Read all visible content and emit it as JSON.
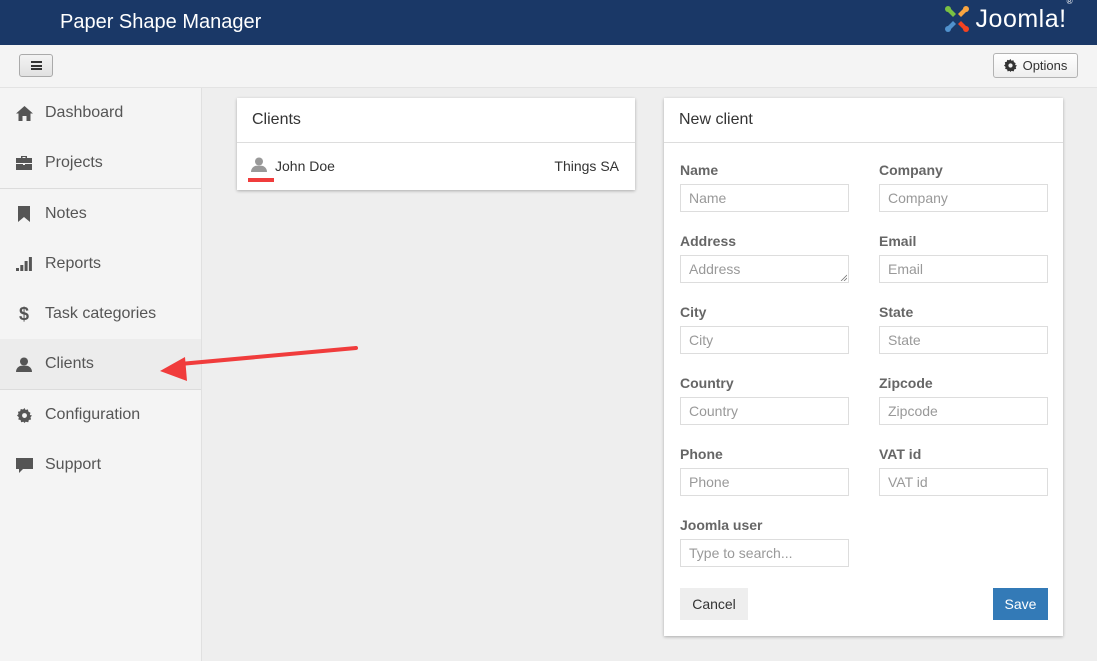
{
  "header": {
    "app_title": "Paper Shape Manager",
    "brand_logo_text": "Joomla!",
    "brand_logo_word": "Joomla",
    "brand_logo_mark": "!",
    "brand_logo_reg": "®"
  },
  "toolbar": {
    "menu_toggle_icon": "hamburger-icon",
    "options_label": "Options",
    "options_icon": "gear-icon"
  },
  "sidebar": {
    "items": [
      {
        "label": "Dashboard",
        "icon": "home-icon",
        "active": false
      },
      {
        "label": "Projects",
        "icon": "briefcase-icon",
        "active": false
      },
      {
        "label": "Notes",
        "icon": "bookmark-icon",
        "active": false
      },
      {
        "label": "Reports",
        "icon": "signal-bars-icon",
        "active": false
      },
      {
        "label": "Task categories",
        "icon": "dollar-icon",
        "active": false
      },
      {
        "label": "Clients",
        "icon": "user-icon",
        "active": true
      },
      {
        "label": "Configuration",
        "icon": "gear-icon",
        "active": false
      },
      {
        "label": "Support",
        "icon": "comment-icon",
        "active": false
      }
    ]
  },
  "clients_panel": {
    "title": "Clients",
    "rows": [
      {
        "name": "John Doe",
        "company": "Things SA",
        "icon": "user-icon"
      }
    ]
  },
  "new_client_panel": {
    "title": "New client",
    "fields": {
      "name": {
        "label": "Name",
        "placeholder": "Name",
        "value": ""
      },
      "company": {
        "label": "Company",
        "placeholder": "Company",
        "value": ""
      },
      "address": {
        "label": "Address",
        "placeholder": "Address",
        "value": ""
      },
      "email": {
        "label": "Email",
        "placeholder": "Email",
        "value": ""
      },
      "city": {
        "label": "City",
        "placeholder": "City",
        "value": ""
      },
      "state": {
        "label": "State",
        "placeholder": "State",
        "value": ""
      },
      "country": {
        "label": "Country",
        "placeholder": "Country",
        "value": ""
      },
      "zipcode": {
        "label": "Zipcode",
        "placeholder": "Zipcode",
        "value": ""
      },
      "phone": {
        "label": "Phone",
        "placeholder": "Phone",
        "value": ""
      },
      "vat_id": {
        "label": "VAT id",
        "placeholder": "VAT id",
        "value": ""
      },
      "joomla_user": {
        "label": "Joomla user",
        "placeholder": "Type to search...",
        "value": ""
      }
    },
    "cancel_label": "Cancel",
    "save_label": "Save"
  },
  "colors": {
    "topbar": "#1a3867",
    "primary_button": "#337ab7",
    "annotation_red": "#f03c3c",
    "sidebar_bg": "#f4f4f4",
    "content_bg": "#eeeeee"
  },
  "annotations": {
    "arrow_target": "Clients",
    "arrow_color": "#f03c3c",
    "underline_target": "client-row-user-icon"
  }
}
